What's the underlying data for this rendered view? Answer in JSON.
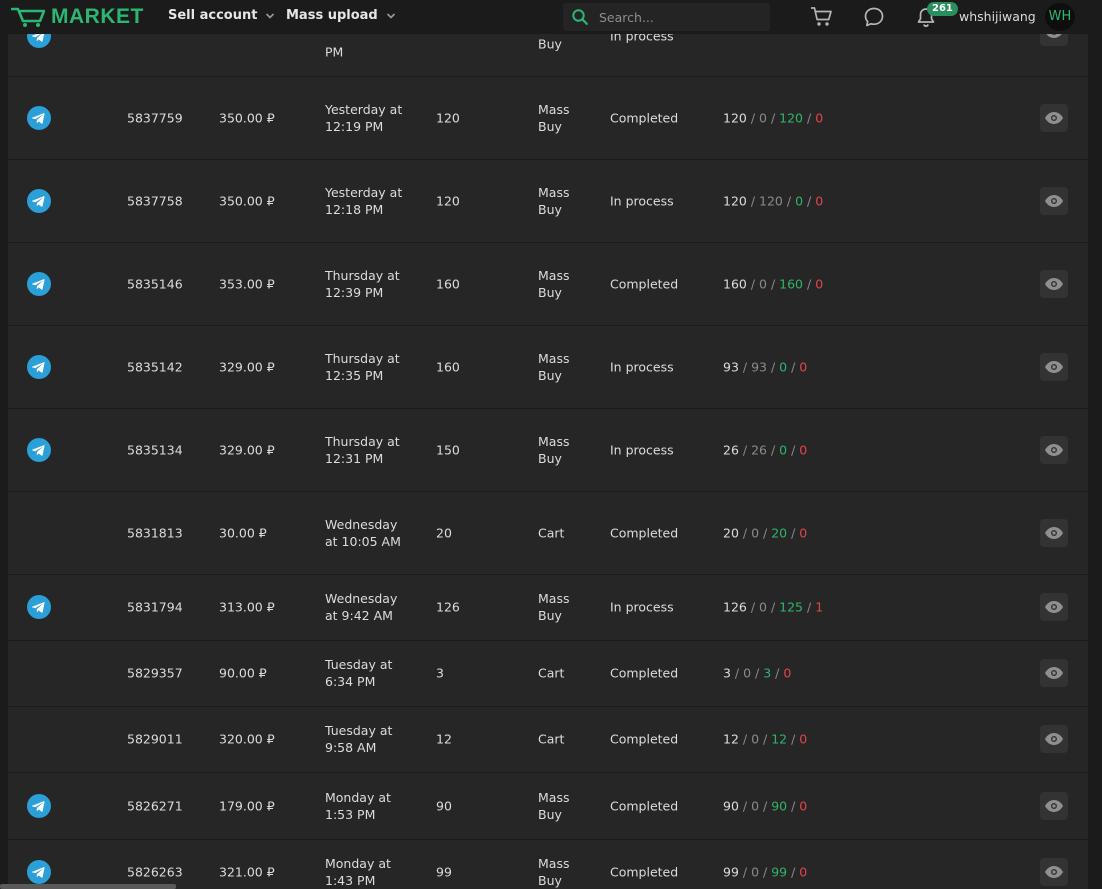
{
  "header": {
    "logo_text": "MARKET",
    "nav": [
      "Sell account",
      "Mass upload"
    ],
    "search_placeholder": "Search...",
    "notifications_count": "261",
    "username": "whshijiwang",
    "avatar_initials": "WH",
    "icons": [
      "cart-icon",
      "chat-icon",
      "bell-icon"
    ]
  },
  "colors": {
    "brand": "#2bb673",
    "success": "#2fb56a",
    "error": "#e0454b",
    "telegram": "#2a9fd8"
  },
  "rows": [
    {
      "telegram": true,
      "id": "5837759",
      "price": "350.00 ₽",
      "date": "Yesterday at 12:19 PM",
      "count": "120",
      "type": "Mass Buy",
      "status": "Completed",
      "stats": [
        "120",
        "0",
        "120",
        "0"
      ]
    },
    {
      "telegram": true,
      "id": "5837758",
      "price": "350.00 ₽",
      "date": "Yesterday at 12:18 PM",
      "count": "120",
      "type": "Mass Buy",
      "status": "In process",
      "stats": [
        "120",
        "120",
        "0",
        "0"
      ]
    },
    {
      "telegram": true,
      "id": "5835146",
      "price": "353.00 ₽",
      "date": "Thursday at 12:39 PM",
      "count": "160",
      "type": "Mass Buy",
      "status": "Completed",
      "stats": [
        "160",
        "0",
        "160",
        "0"
      ]
    },
    {
      "telegram": true,
      "id": "5835142",
      "price": "329.00 ₽",
      "date": "Thursday at 12:35 PM",
      "count": "160",
      "type": "Mass Buy",
      "status": "In process",
      "stats": [
        "93",
        "93",
        "0",
        "0"
      ]
    },
    {
      "telegram": true,
      "id": "5835134",
      "price": "329.00 ₽",
      "date": "Thursday at 12:31 PM",
      "count": "150",
      "type": "Mass Buy",
      "status": "In process",
      "stats": [
        "26",
        "26",
        "0",
        "0"
      ]
    },
    {
      "telegram": false,
      "id": "5831813",
      "price": "30.00 ₽",
      "date": "Wednesday at 10:05 AM",
      "count": "20",
      "type": "Cart",
      "status": "Completed",
      "stats": [
        "20",
        "0",
        "20",
        "0"
      ]
    },
    {
      "telegram": true,
      "id": "5831794",
      "price": "313.00 ₽",
      "date": "Wednesday at 9:42 AM",
      "count": "126",
      "type": "Mass Buy",
      "status": "In process",
      "stats": [
        "126",
        "0",
        "125",
        "1"
      ]
    },
    {
      "telegram": false,
      "id": "5829357",
      "price": "90.00 ₽",
      "date": "Tuesday at 6:34 PM",
      "count": "3",
      "type": "Cart",
      "status": "Completed",
      "stats": [
        "3",
        "0",
        "3",
        "0"
      ]
    },
    {
      "telegram": false,
      "id": "5829011",
      "price": "320.00 ₽",
      "date": "Tuesday at 9:58 AM",
      "count": "12",
      "type": "Cart",
      "status": "Completed",
      "stats": [
        "12",
        "0",
        "12",
        "0"
      ]
    },
    {
      "telegram": true,
      "id": "5826271",
      "price": "179.00 ₽",
      "date": "Monday at 1:53 PM",
      "count": "90",
      "type": "Mass Buy",
      "status": "Completed",
      "stats": [
        "90",
        "0",
        "90",
        "0"
      ]
    },
    {
      "telegram": true,
      "id": "5826263",
      "price": "321.00 ₽",
      "date": "Monday at 1:43 PM",
      "count": "99",
      "type": "Mass Buy",
      "status": "Completed",
      "stats": [
        "99",
        "0",
        "99",
        "0"
      ]
    }
  ],
  "partial_top_row": {
    "telegram": true,
    "date_tail": "PM",
    "type_tail": "Buy",
    "status": "In process"
  }
}
